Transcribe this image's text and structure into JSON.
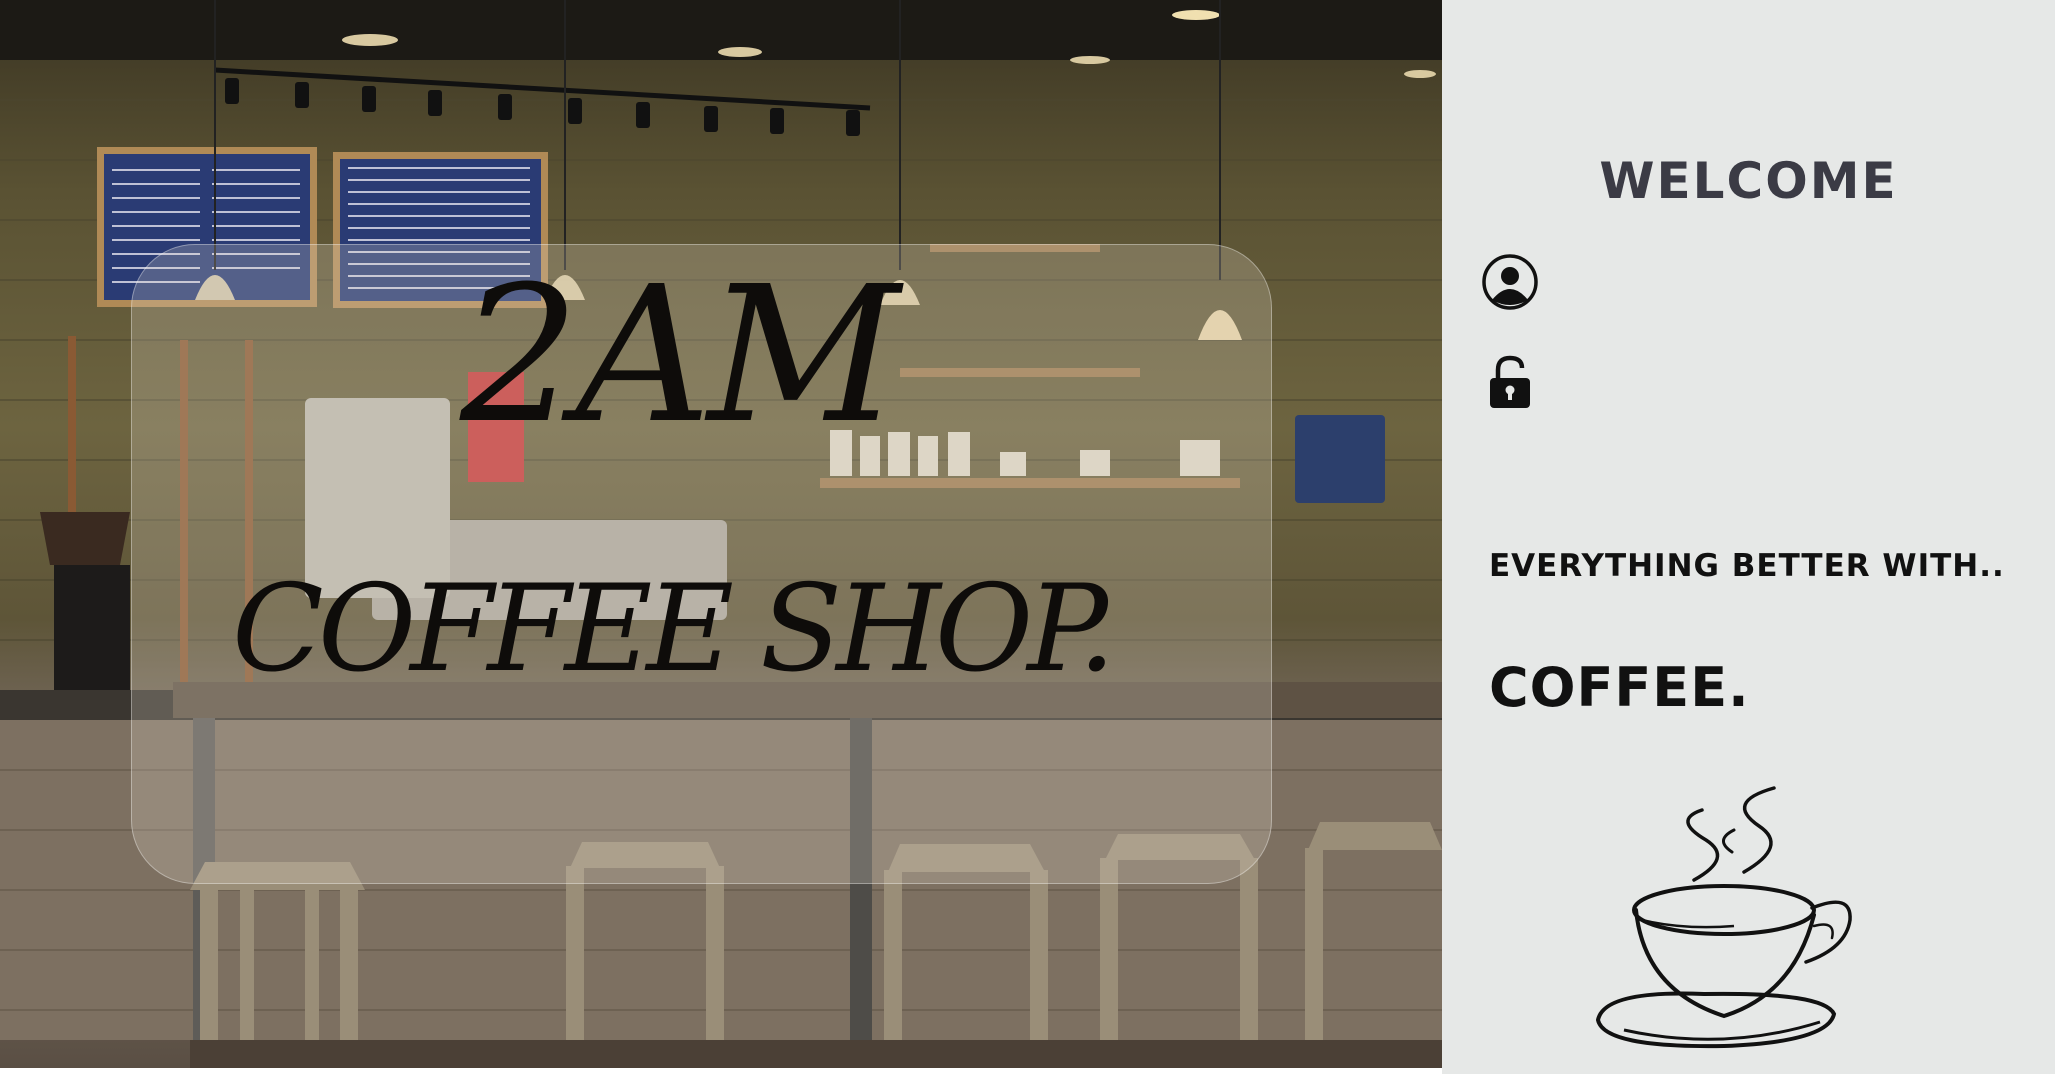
{
  "hero": {
    "title_line1": "2AM",
    "title_line2": "COFFEE SHOP."
  },
  "sidebar": {
    "welcome": "WELCOME",
    "username_icon": "user-circle-icon",
    "password_icon": "unlock-icon",
    "username_value": "",
    "password_value": "",
    "tagline": "EVERYTHING BETTER WITH..",
    "coffee_word": "COFFEE.",
    "cup_icon": "coffee-cup-icon"
  },
  "colors": {
    "sidebar_bg": "#e6e8e7",
    "welcome_text": "#3b3b45",
    "title_text": "#0e0c0a"
  }
}
